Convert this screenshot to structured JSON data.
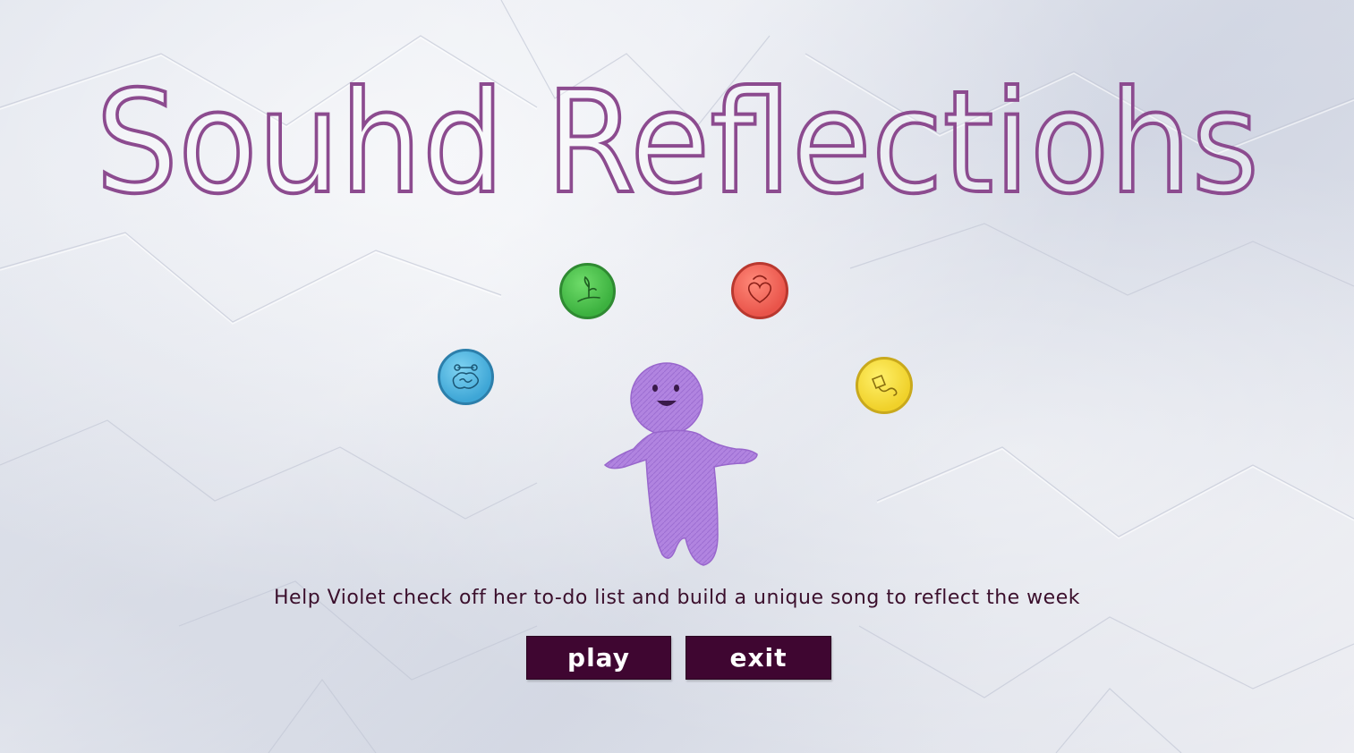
{
  "title": "Souhd Reflectiohs",
  "tagline": "Help Violet check off her to-do list and build a unique song to reflect the week",
  "buttons": {
    "play_label": "play",
    "exit_label": "exit"
  },
  "tokens": [
    {
      "name": "green",
      "icon": "plant-sprout-icon",
      "color": "#3cb13f"
    },
    {
      "name": "red",
      "icon": "heart-icon",
      "color": "#e9544a"
    },
    {
      "name": "blue",
      "icon": "brain-dumbbell-icon",
      "color": "#3ea6d6"
    },
    {
      "name": "yellow",
      "icon": "kite-icon",
      "color": "#f0d12a"
    }
  ],
  "colors": {
    "title_outline": "#8c4b8f",
    "button_bg": "#3f0631",
    "tagline": "#3b0f2c",
    "character": "#b184e0"
  }
}
